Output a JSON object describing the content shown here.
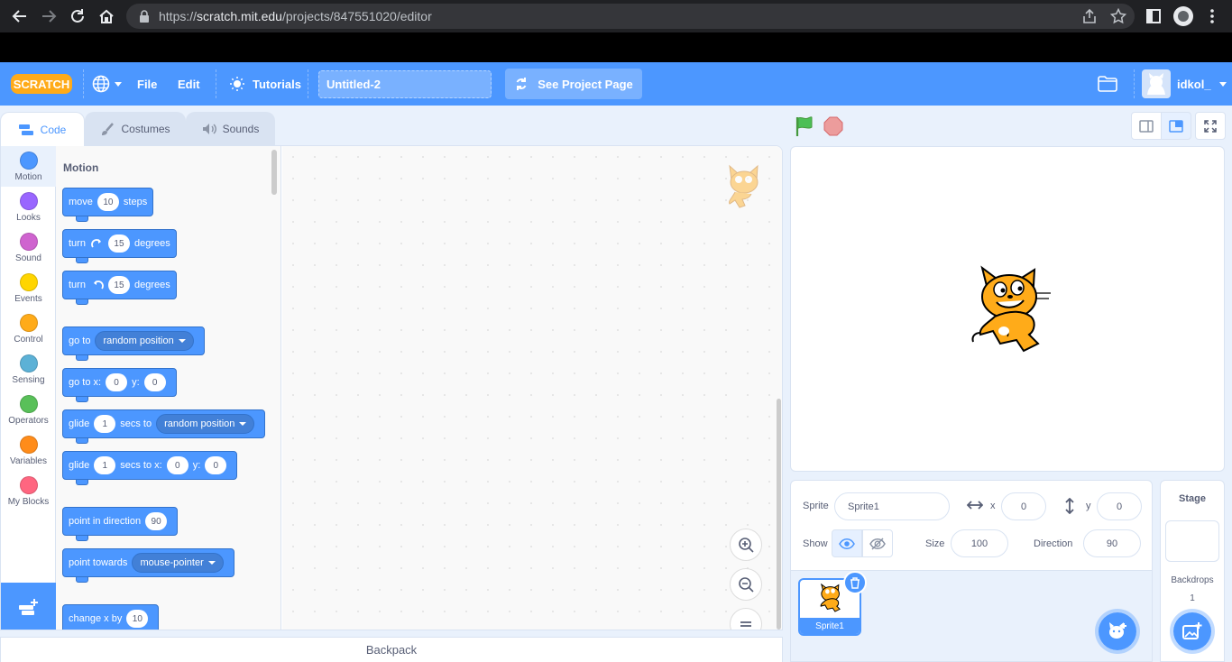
{
  "browser": {
    "url_domain": "scratch.mit.edu",
    "url_path": "/projects/847551020/editor"
  },
  "menu": {
    "logo": "SCRATCH",
    "file": "File",
    "edit": "Edit",
    "tutorials": "Tutorials",
    "project_title": "Untitled-2",
    "see_project_page": "See Project Page",
    "username": "idkol_"
  },
  "tabs": {
    "code": "Code",
    "costumes": "Costumes",
    "sounds": "Sounds"
  },
  "categories": [
    {
      "label": "Motion",
      "color": "#4c97ff"
    },
    {
      "label": "Looks",
      "color": "#9966ff"
    },
    {
      "label": "Sound",
      "color": "#cf63cf"
    },
    {
      "label": "Events",
      "color": "#ffd500"
    },
    {
      "label": "Control",
      "color": "#ffab19"
    },
    {
      "label": "Sensing",
      "color": "#5cb1d6"
    },
    {
      "label": "Operators",
      "color": "#59c059"
    },
    {
      "label": "Variables",
      "color": "#ff8c1a"
    },
    {
      "label": "My Blocks",
      "color": "#ff6680"
    }
  ],
  "palette": {
    "heading": "Motion",
    "move": {
      "t1": "move",
      "v1": "10",
      "t2": "steps"
    },
    "turn_right": {
      "t1": "turn",
      "v1": "15",
      "t2": "degrees"
    },
    "turn_left": {
      "t1": "turn",
      "v1": "15",
      "t2": "degrees"
    },
    "go_to": {
      "t1": "go to",
      "d1": "random position"
    },
    "go_to_xy": {
      "t1": "go to x:",
      "v1": "0",
      "t2": "y:",
      "v2": "0"
    },
    "glide_to": {
      "t1": "glide",
      "v1": "1",
      "t2": "secs to",
      "d1": "random position"
    },
    "glide_xy": {
      "t1": "glide",
      "v1": "1",
      "t2": "secs to x:",
      "v2": "0",
      "t3": "y:",
      "v3": "0"
    },
    "point_dir": {
      "t1": "point in direction",
      "v1": "90"
    },
    "point_towards": {
      "t1": "point towards",
      "d1": "mouse-pointer"
    },
    "change_x": {
      "t1": "change x by",
      "v1": "10"
    }
  },
  "backpack": "Backpack",
  "sprite_info": {
    "sprite_label": "Sprite",
    "sprite_name": "Sprite1",
    "x_label": "x",
    "x_value": "0",
    "y_label": "y",
    "y_value": "0",
    "show_label": "Show",
    "size_label": "Size",
    "size_value": "100",
    "direction_label": "Direction",
    "direction_value": "90"
  },
  "sprite_list": {
    "sprite_name": "Sprite1"
  },
  "stage_panel": {
    "title": "Stage",
    "backdrops_label": "Backdrops",
    "backdrops_count": "1"
  }
}
